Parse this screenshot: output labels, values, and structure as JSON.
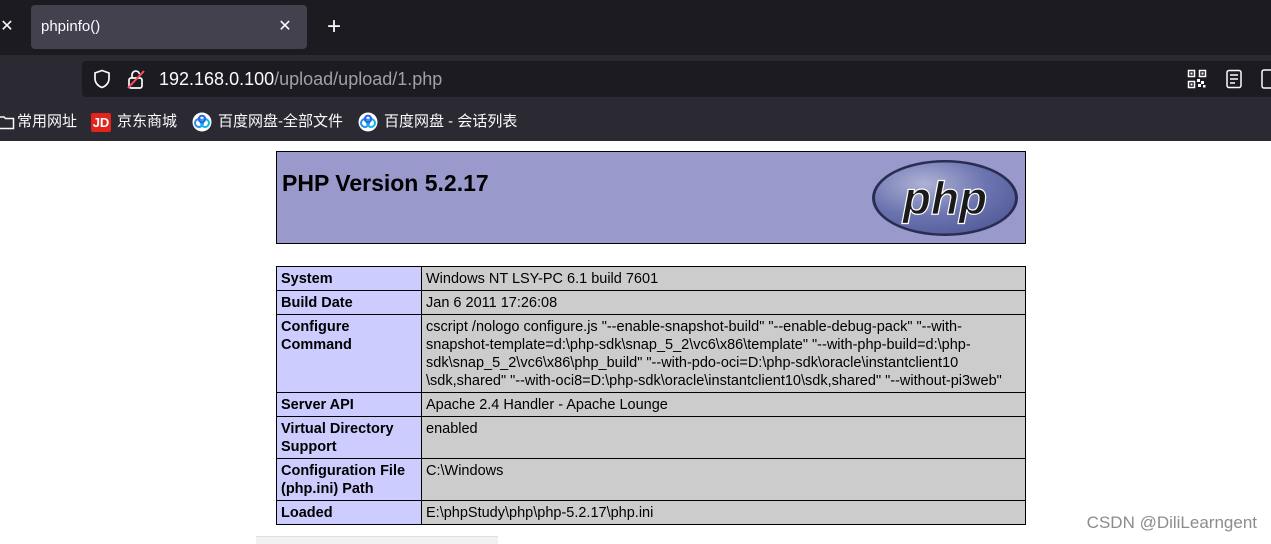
{
  "browser": {
    "prev_tab_close": "✕",
    "tab": {
      "title": "phpinfo()",
      "close": "✕"
    },
    "new_tab": "+",
    "url": {
      "host": "192.168.0.100",
      "path": "/upload/upload/1.php"
    }
  },
  "bookmarks": [
    {
      "label": "常用网址",
      "icon": "folder-icon"
    },
    {
      "label": "京东商城",
      "icon": "jd-icon",
      "icon_text": "JD"
    },
    {
      "label": "百度网盘-全部文件",
      "icon": "baidu-netdisk-icon"
    },
    {
      "label": "百度网盘 - 会话列表",
      "icon": "baidu-netdisk-icon"
    }
  ],
  "phpinfo": {
    "title": "PHP Version 5.2.17",
    "rows": [
      {
        "key": "System",
        "value": "Windows NT LSY-PC 6.1 build 7601"
      },
      {
        "key": "Build Date",
        "value": "Jan 6 2011 17:26:08"
      },
      {
        "key_lines": [
          "Configure",
          "Command"
        ],
        "value_lines": [
          "cscript /nologo configure.js \"--enable-snapshot-build\" \"--enable-debug-pack\" \"--with-",
          "snapshot-template=d:\\php-sdk\\snap_5_2\\vc6\\x86\\template\" \"--with-php-build=d:\\php-",
          "sdk\\snap_5_2\\vc6\\x86\\php_build\" \"--with-pdo-oci=D:\\php-sdk\\oracle\\instantclient10",
          "\\sdk,shared\" \"--with-oci8=D:\\php-sdk\\oracle\\instantclient10\\sdk,shared\" \"--without-pi3web\""
        ]
      },
      {
        "key": "Server API",
        "value": "Apache 2.4 Handler - Apache Lounge"
      },
      {
        "key_lines": [
          "Virtual Directory",
          "Support"
        ],
        "value": "enabled"
      },
      {
        "key_lines": [
          "Configuration File",
          "(php.ini) Path"
        ],
        "value": "C:\\Windows"
      },
      {
        "key": "Loaded",
        "value": "E:\\phpStudy\\php\\php-5.2.17\\php.ini"
      }
    ]
  },
  "watermark": "CSDN @DiliLearngent",
  "colors": {
    "tab_strip": "#1c1b22",
    "toolbar": "#2b2a33",
    "header_bg": "#9999cc",
    "key_bg": "#ccccff",
    "value_bg": "#cccccc",
    "jd_red": "#e1251b"
  }
}
